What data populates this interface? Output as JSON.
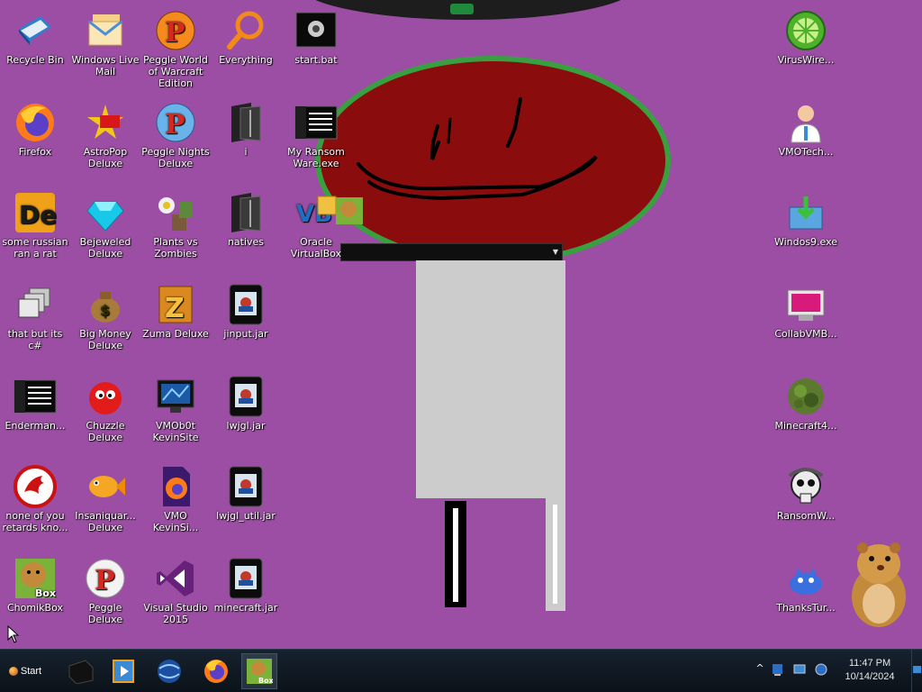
{
  "desktop": {
    "icons": [
      {
        "id": "recycle-bin",
        "label": "Recycle Bin",
        "icon": "recycle-bin-icon"
      },
      {
        "id": "windows-live-mail",
        "label": "Windows Live Mail",
        "icon": "mail-icon"
      },
      {
        "id": "peggle-wow",
        "label": "Peggle World of Warcraft Edition",
        "icon": "peggle-icon"
      },
      {
        "id": "everything",
        "label": "Everything",
        "icon": "magnifier-icon"
      },
      {
        "id": "start-bat",
        "label": "start.bat",
        "icon": "batch-file-icon"
      },
      {
        "id": "firefox",
        "label": "Firefox",
        "icon": "firefox-icon"
      },
      {
        "id": "astropop",
        "label": "AstroPop Deluxe",
        "icon": "astropop-icon"
      },
      {
        "id": "peggle-nights",
        "label": "Peggle Nights Deluxe",
        "icon": "peggle-icon"
      },
      {
        "id": "folder-i",
        "label": "i",
        "icon": "folder-icon"
      },
      {
        "id": "my-ransomware",
        "label": "My Ransom Ware.exe",
        "icon": "console-app-icon"
      },
      {
        "id": "russian-rat",
        "label": "some russian ran a rat",
        "icon": "de-icon"
      },
      {
        "id": "bejeweled",
        "label": "Bejeweled Deluxe",
        "icon": "gem-icon"
      },
      {
        "id": "pvz",
        "label": "Plants vs Zombies",
        "icon": "plant-icon"
      },
      {
        "id": "natives",
        "label": "natives",
        "icon": "folder-icon"
      },
      {
        "id": "virtualbox",
        "label": "Oracle VirtualBox",
        "icon": "virtualbox-icon"
      },
      {
        "id": "that-but-csharp",
        "label": "that but its c#",
        "icon": "windows-stack-icon"
      },
      {
        "id": "big-money",
        "label": "Big Money Deluxe",
        "icon": "money-bag-icon"
      },
      {
        "id": "zuma",
        "label": "Zuma Deluxe",
        "icon": "zuma-icon"
      },
      {
        "id": "jinput",
        "label": "jinput.jar",
        "icon": "jar-file-icon"
      },
      {
        "id": "enderman",
        "label": "Enderman...",
        "icon": "console-app-icon"
      },
      {
        "id": "chuzzle",
        "label": "Chuzzle Deluxe",
        "icon": "chuzzle-icon"
      },
      {
        "id": "vmobot",
        "label": "VMOb0t KevinSite",
        "icon": "monitor-icon"
      },
      {
        "id": "lwjgl",
        "label": "lwjgl.jar",
        "icon": "jar-file-icon"
      },
      {
        "id": "none-of-you",
        "label": "none of you retards kno...",
        "icon": "dragon-icon"
      },
      {
        "id": "insaniquarium",
        "label": "Insaniquar... Deluxe",
        "icon": "fish-icon"
      },
      {
        "id": "vmo-kevinsi",
        "label": "VMO KevinSi...",
        "icon": "firefox-file-icon"
      },
      {
        "id": "lwjgl-util",
        "label": "lwjgl_util.jar",
        "icon": "jar-file-icon"
      },
      {
        "id": "chomikbox",
        "label": "ChomikBox",
        "icon": "chomik-icon"
      },
      {
        "id": "peggle-deluxe",
        "label": "Peggle Deluxe",
        "icon": "peggle-icon"
      },
      {
        "id": "visual-studio",
        "label": "Visual Studio 2015",
        "icon": "visual-studio-icon"
      },
      {
        "id": "minecraft-jar",
        "label": "minecraft.jar",
        "icon": "jar-file-icon"
      },
      {
        "id": "viruswire",
        "label": "VirusWire...",
        "icon": "lime-icon"
      },
      {
        "id": "vmotech",
        "label": "VMOTech...",
        "icon": "doctor-icon"
      },
      {
        "id": "windos9",
        "label": "Windos9.exe",
        "icon": "installer-icon"
      },
      {
        "id": "collabvm",
        "label": "CollabVMB...",
        "icon": "monitor-pink-icon"
      },
      {
        "id": "minecraft4",
        "label": "Minecraft4...",
        "icon": "grass-block-icon"
      },
      {
        "id": "ransomw",
        "label": "RansomW...",
        "icon": "skull-icon"
      },
      {
        "id": "thankstur",
        "label": "ThanksTur...",
        "icon": "blue-creature-icon"
      }
    ]
  },
  "taskbar": {
    "start_label": "Start",
    "apps": [
      {
        "id": "cmd",
        "label": "Command Prompt",
        "icon": "terminal-icon"
      },
      {
        "id": "media",
        "label": "Media Player",
        "icon": "media-icon"
      },
      {
        "id": "ie",
        "label": "Internet Explorer",
        "icon": "globe-icon"
      },
      {
        "id": "firefox",
        "label": "Firefox",
        "icon": "firefox-icon"
      },
      {
        "id": "chomikbox",
        "label": "ChomikBox",
        "icon": "chomik-icon"
      }
    ],
    "clock": {
      "time": "11:47 PM",
      "date": "10/14/2024"
    },
    "tray_chevron": "^"
  },
  "colors": {
    "desktop_bg": "#9b4ea3",
    "face": "#8b0c0c",
    "face_outline": "#38a040",
    "taskbar": "#0f1821"
  }
}
